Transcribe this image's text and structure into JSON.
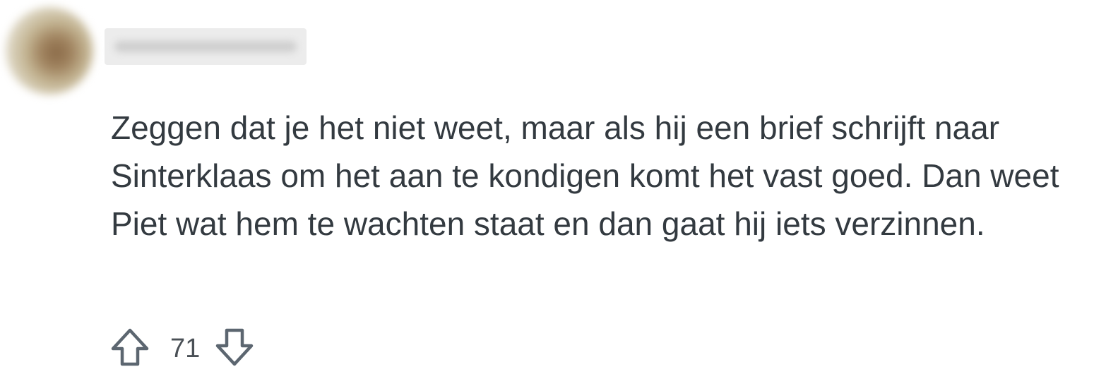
{
  "comment": {
    "username": "",
    "body": "Zeggen dat je het niet weet, maar als hij een brief schrijft naar Sinterklaas om het aan te kondigen komt het vast goed. Dan weet Piet wat hem te wachten staat en dan gaat hij iets verzinnen.",
    "score": "71"
  },
  "icons": {
    "upvote": "arrow-up-icon",
    "downvote": "arrow-down-icon"
  },
  "colors": {
    "text": "#333a40",
    "icon": "#5c6670"
  }
}
